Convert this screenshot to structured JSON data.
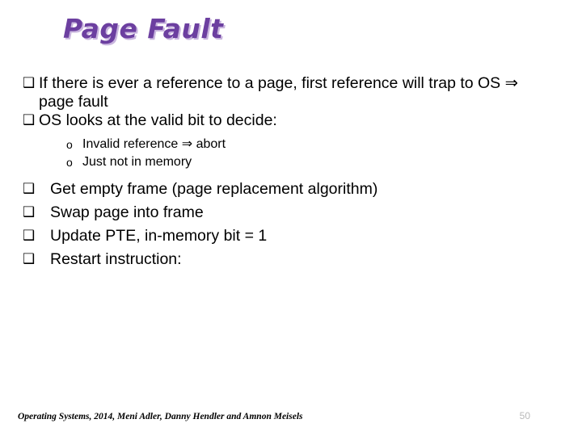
{
  "slide": {
    "title": "Page Fault",
    "title_color": "#6C3FA0",
    "title_shadow_color": "#C9B6DE",
    "background_color": "#ffffff"
  },
  "markers": {
    "square": "❑",
    "circle": "o",
    "arrow": "⇒"
  },
  "content": {
    "bullets": [
      {
        "level": 1,
        "marker": "❑",
        "text": "If there is ever a reference to a page, first reference will trap to OS ⇒ page fault"
      },
      {
        "level": 1,
        "marker": "❑",
        "text": "OS looks at the valid bit to decide:"
      },
      {
        "level": 2,
        "marker": "o",
        "text": "Invalid reference ⇒ abort"
      },
      {
        "level": 2,
        "marker": "o",
        "text": "Just not in memory"
      },
      {
        "level": 1,
        "marker": "❑",
        "text": "Get empty frame (page replacement algorithm)"
      },
      {
        "level": 1,
        "marker": "❑",
        "text": "Swap page into frame"
      },
      {
        "level": 1,
        "marker": "❑",
        "text": "Update PTE, in-memory bit = 1"
      },
      {
        "level": 1,
        "marker": "❑",
        "text": "Restart instruction:"
      }
    ]
  },
  "footer": {
    "credit": "Operating Systems, 2014, Meni Adler, Danny Hendler and Amnon Meisels",
    "page_number": "50",
    "page_number_color": "#B9B9B9"
  }
}
